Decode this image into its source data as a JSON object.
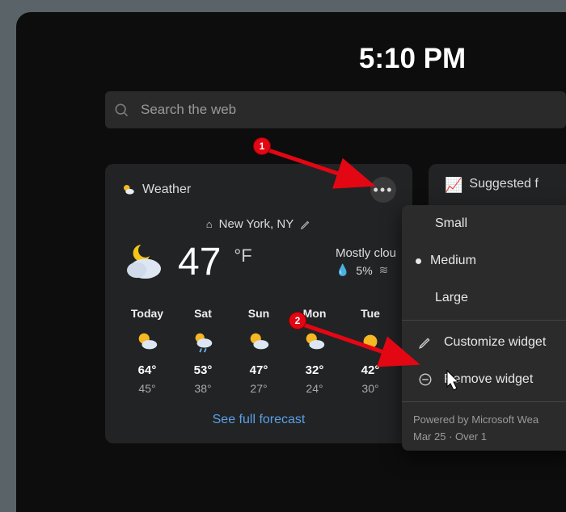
{
  "clock": "5:10 PM",
  "search": {
    "placeholder": "Search the web"
  },
  "weather": {
    "title": "Weather",
    "location": "New York, NY",
    "temp": "47",
    "unit": "°F",
    "condition": "Mostly clou",
    "precip": "5%",
    "forecast_link": "See full forecast",
    "days": [
      {
        "label": "Today",
        "hi": "64°",
        "lo": "45°"
      },
      {
        "label": "Sat",
        "hi": "53°",
        "lo": "38°"
      },
      {
        "label": "Sun",
        "hi": "47°",
        "lo": "27°"
      },
      {
        "label": "Mon",
        "hi": "32°",
        "lo": "24°"
      },
      {
        "label": "Tue",
        "hi": "42°",
        "lo": "30°"
      }
    ]
  },
  "suggested": {
    "title": "Suggested f"
  },
  "menu": {
    "small": "Small",
    "medium": "Medium",
    "large": "Large",
    "customize": "Customize widget",
    "remove": "Remove widget",
    "footer1": "Powered by Microsoft Wea",
    "footer2": "Mar 25 · Over 1"
  },
  "annotations": {
    "step1": "1",
    "step2": "2"
  }
}
